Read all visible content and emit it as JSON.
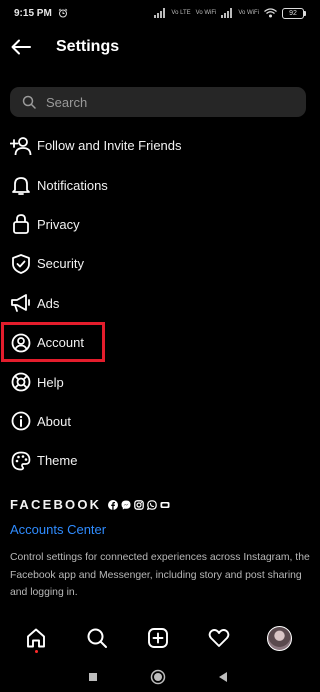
{
  "status_bar": {
    "time": "9:15 PM",
    "battery": "92",
    "signal_labels": [
      "Vo LTE",
      "Vo WiFi",
      "Vo WiFi"
    ]
  },
  "header": {
    "title": "Settings"
  },
  "search": {
    "placeholder": "Search"
  },
  "menu": {
    "items": [
      {
        "label": "Follow and Invite Friends",
        "icon": "add-person-icon"
      },
      {
        "label": "Notifications",
        "icon": "bell-icon"
      },
      {
        "label": "Privacy",
        "icon": "lock-icon"
      },
      {
        "label": "Security",
        "icon": "shield-check-icon"
      },
      {
        "label": "Ads",
        "icon": "megaphone-icon"
      },
      {
        "label": "Account",
        "icon": "profile-circle-icon",
        "highlighted": true
      },
      {
        "label": "Help",
        "icon": "lifebuoy-icon"
      },
      {
        "label": "About",
        "icon": "info-icon"
      },
      {
        "label": "Theme",
        "icon": "palette-icon"
      }
    ]
  },
  "facebook": {
    "wordmark": "FACEBOOK",
    "app_icons": [
      "facebook-icon",
      "messenger-icon",
      "instagram-icon",
      "whatsapp-icon",
      "portal-icon"
    ],
    "accounts_center": "Accounts Center",
    "description": "Control settings for connected experiences across Instagram, the Facebook app and Messenger, including story and post sharing and logging in."
  },
  "bottom_nav": [
    "home-icon",
    "search-icon",
    "new-post-icon",
    "heart-icon",
    "profile-avatar"
  ],
  "colors": {
    "background": "#000000",
    "highlight": "#e41d2c",
    "link": "#2f8cff",
    "search_bg": "#262626"
  }
}
